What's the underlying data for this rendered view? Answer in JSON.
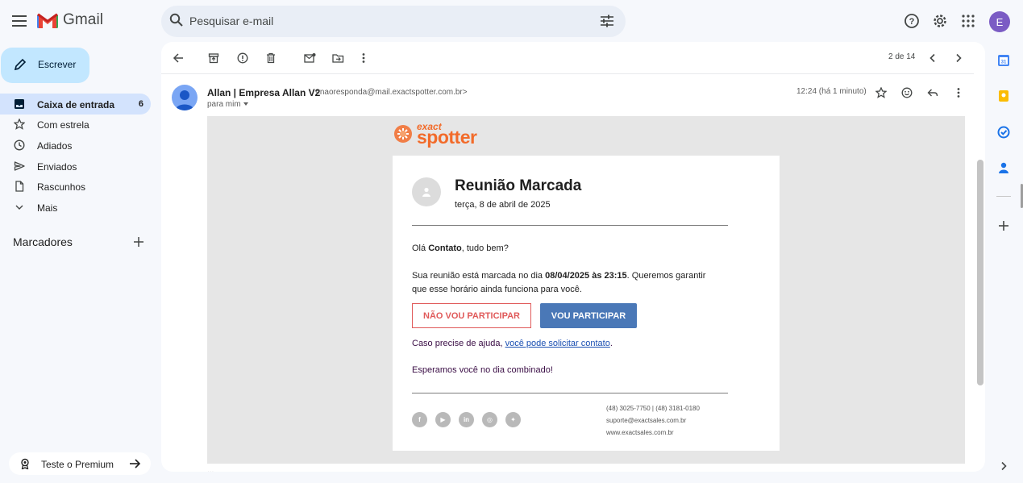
{
  "header": {
    "app_name": "Gmail",
    "search_placeholder": "Pesquisar e-mail",
    "avatar_letter": "E"
  },
  "sidebar": {
    "compose_label": "Escrever",
    "items": [
      {
        "label": "Caixa de entrada",
        "count": "6",
        "icon": "inbox-icon"
      },
      {
        "label": "Com estrela",
        "icon": "star-icon"
      },
      {
        "label": "Adiados",
        "icon": "clock-icon"
      },
      {
        "label": "Enviados",
        "icon": "send-icon"
      },
      {
        "label": "Rascunhos",
        "icon": "draft-icon"
      },
      {
        "label": "Mais",
        "icon": "chevron-down-icon"
      }
    ],
    "labels_title": "Marcadores",
    "premium_label": "Teste o Premium"
  },
  "toolbar": {
    "pager": "2 de 14"
  },
  "message": {
    "sender_name": "Allan | Empresa Allan V2",
    "sender_email": "<naoresponda@mail.exactspotter.com.br>",
    "to": "para mim",
    "time": "12:24 (há 1 minuto)",
    "more": "..."
  },
  "email": {
    "logo_top": "exact",
    "logo_bottom": "spotter",
    "title": "Reunião Marcada",
    "date": "terça, 8 de abril de 2025",
    "greeting_pre": "Olá ",
    "greeting_name": "Contato",
    "greeting_post": ", tudo bem?",
    "meeting_pre": "Sua reunião está marcada no dia ",
    "meeting_when": "08/04/2025 às 23:15",
    "meeting_post": ". Queremos garantir",
    "meeting_line2": "que esse horário ainda funciona para você.",
    "decline_label": "NÃO VOU PARTICIPAR",
    "accept_label": "VOU PARTICIPAR",
    "help_pre": "Caso precise de ajuda, ",
    "help_link": "você pode solicitar contato",
    "help_post": ".",
    "closing": "Esperamos você no dia combinado!",
    "phone": "(48) 3025-7750 | (48) 3181-0180",
    "support_email": "suporte@exactsales.com.br",
    "website": "www.exactsales.com.br",
    "social": [
      "facebook-icon",
      "youtube-icon",
      "linkedin-icon",
      "instagram-icon",
      "twitter-icon"
    ]
  },
  "colors": {
    "compose_bg": "#c2e7ff",
    "active_nav": "#d3e3fd",
    "decline": "#e05a5a",
    "accept": "#4a78b7",
    "logo_orange": "#f26b2a"
  }
}
